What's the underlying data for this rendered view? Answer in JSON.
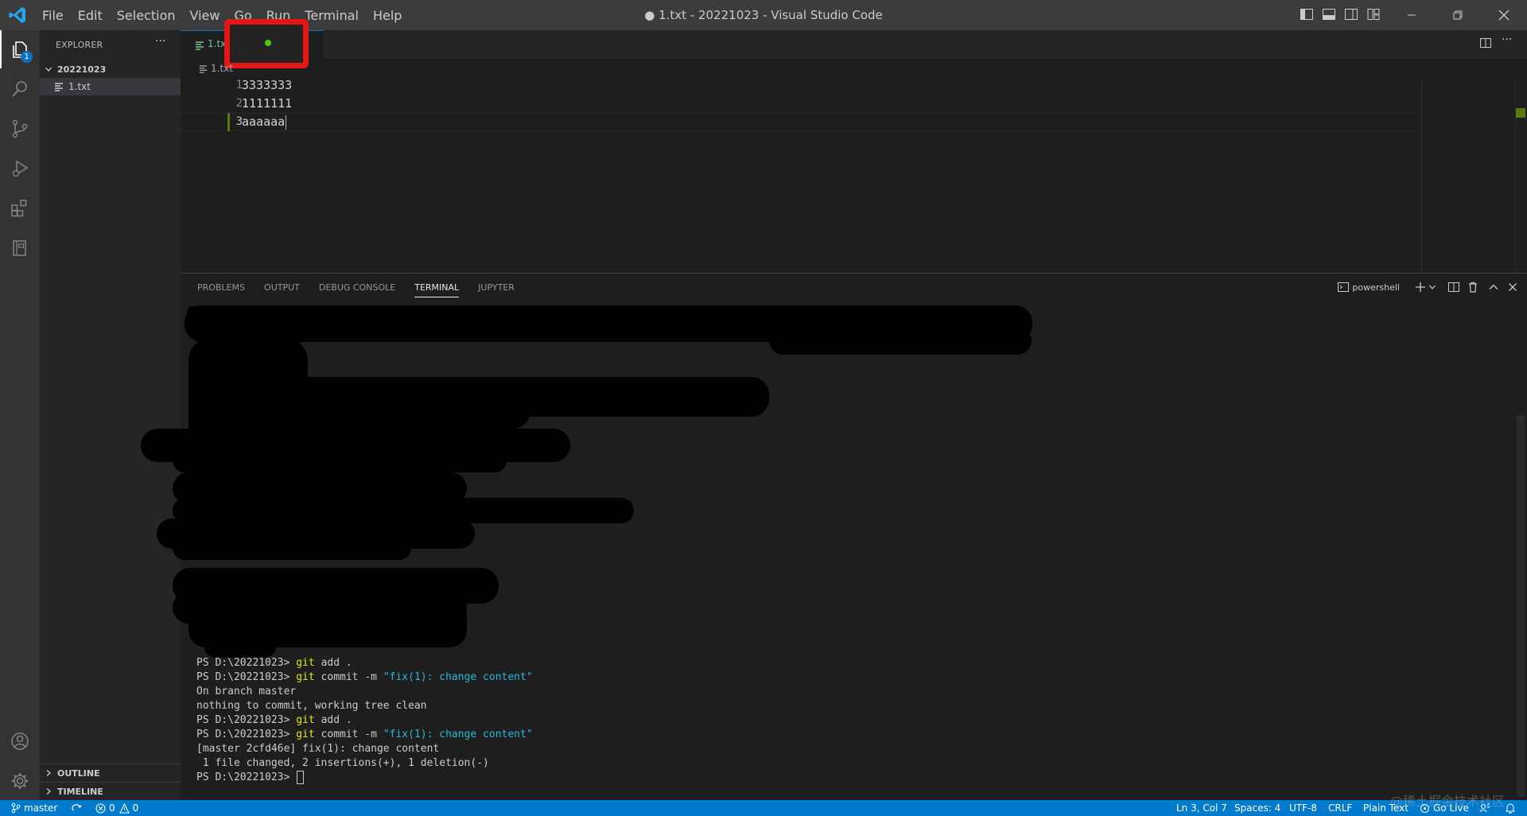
{
  "menu": [
    "File",
    "Edit",
    "Selection",
    "View",
    "Go",
    "Run",
    "Terminal",
    "Help"
  ],
  "window_title": "● 1.txt - 20221023 - Visual Studio Code",
  "activity": {
    "explorer_badge": "1"
  },
  "sidebar": {
    "title": "EXPLORER",
    "more": "···",
    "folder": "20221023",
    "file": "1.txt",
    "outline": "OUTLINE",
    "timeline": "TIMELINE"
  },
  "tab": {
    "label": "1.txt"
  },
  "breadcrumb": "1.txt",
  "editor": {
    "lines": [
      {
        "num": "1",
        "text": "3333333"
      },
      {
        "num": "2",
        "text": "1111111"
      },
      {
        "num": "3",
        "text": "aaaaaa"
      }
    ]
  },
  "panel": {
    "tabs": [
      "PROBLEMS",
      "OUTPUT",
      "DEBUG CONSOLE",
      "TERMINAL",
      "JUPYTER"
    ],
    "shell": "powershell"
  },
  "terminal": {
    "prompt": "PS D:\\20221023> ",
    "l1_cmd": "git",
    "l1_rest": " add .",
    "l2_cmd": "git",
    "l2_mid": " commit -m ",
    "l2_str": "\"fix(1): change content\"",
    "l3": "On branch master",
    "l4": "nothing to commit, working tree clean",
    "l5_cmd": "git",
    "l5_rest": " add .",
    "l6_cmd": "git",
    "l6_mid": " commit -m ",
    "l6_str": "\"fix(1): change content\"",
    "l7": "[master 2cfd46e] fix(1): change content",
    "l8": " 1 file changed, 2 insertions(+), 1 deletion(-)"
  },
  "status": {
    "branch": "master",
    "errors": "0",
    "warnings": "0",
    "position": "Ln 3, Col 7",
    "spaces": "Spaces: 4",
    "encoding": "UTF-8",
    "eol": "CRLF",
    "language": "Plain Text",
    "golive": "Go Live"
  },
  "watermark": "@稀土掘金技术社区",
  "colors": {
    "accent": "#007acc",
    "modified": "#73c991",
    "dirty": "#4cc712",
    "annotation": "#e51616"
  }
}
